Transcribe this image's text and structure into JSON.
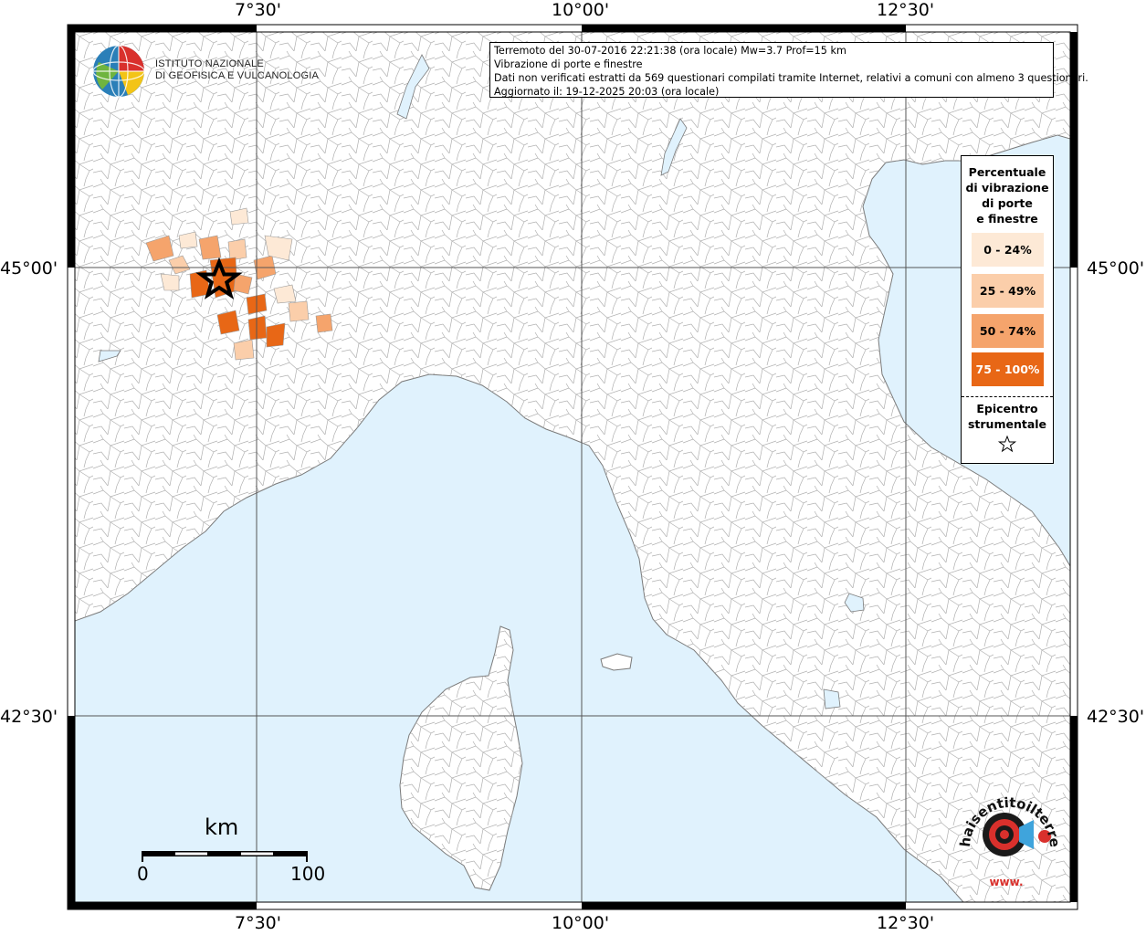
{
  "coordinates": {
    "lon_labels": [
      "7°30'",
      "10°00'",
      "12°30'"
    ],
    "lat_labels": [
      "45°00'",
      "42°30'"
    ]
  },
  "institute": {
    "line1": "ISTITUTO NAZIONALE",
    "line2": "DI GEOFISICA E VULCANOLOGIA"
  },
  "info": {
    "line1": "Terremoto del 30-07-2016 22:21:38 (ora locale) Mw=3.7 Prof=15 km",
    "line2": "Vibrazione di porte e finestre",
    "line3": "Dati non verificati estratti da 569 questionari compilati tramite Internet, relativi a comuni con almeno 3 questionari.",
    "line4": "Aggiornato il: 19-12-2025 20:03 (ora locale)"
  },
  "legend": {
    "title_lines": [
      "Percentuale",
      "di vibrazione",
      "di porte",
      "e finestre"
    ],
    "classes": [
      {
        "label": "0 - 24%",
        "color": "#fde9d6"
      },
      {
        "label": "25 - 49%",
        "color": "#fbceaa"
      },
      {
        "label": "50 - 74%",
        "color": "#f5a46c"
      },
      {
        "label": "75 - 100%",
        "color": "#e86716"
      }
    ],
    "epicenter_lines": [
      "Epicentro",
      "strumentale"
    ]
  },
  "scale": {
    "unit": "km",
    "start": "0",
    "end": "100"
  },
  "brand": {
    "text": "haisentitoilterremoto.it",
    "url_text": "www."
  },
  "colors": {
    "sea": "#e0f2fd",
    "land": "#ffffff",
    "border_lines": "#a8a8a8"
  }
}
